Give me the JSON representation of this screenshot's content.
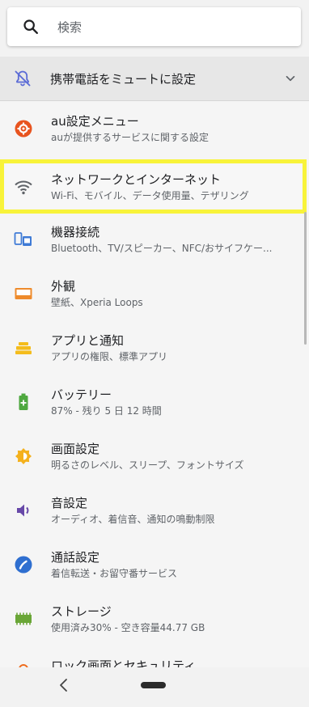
{
  "search": {
    "placeholder": "検索"
  },
  "suggestion": {
    "label": "携帯電話をミュートに設定"
  },
  "settings": [
    {
      "title": "au設定メニュー",
      "subtitle": "auが提供するサービスに関する設定",
      "icon": "au-gear-icon",
      "color": "#e8541f"
    },
    {
      "title": "ネットワークとインターネット",
      "subtitle": "Wi-Fi、モバイル、データ使用量、テザリング",
      "icon": "wifi-icon",
      "color": "#5f6368"
    },
    {
      "title": "機器接続",
      "subtitle": "Bluetooth、TV/スピーカー、NFC/おサイフケー...",
      "icon": "devices-icon",
      "color": "#3f7bd6"
    },
    {
      "title": "外観",
      "subtitle": "壁紙、Xperia Loops",
      "icon": "appearance-icon",
      "color": "#ee8b2c"
    },
    {
      "title": "アプリと通知",
      "subtitle": "アプリの権限、標準アプリ",
      "icon": "apps-icon",
      "color": "#f4bc1c"
    },
    {
      "title": "バッテリー",
      "subtitle": "87% - 残り 5 日 12 時間",
      "icon": "battery-icon",
      "color": "#4ea83f"
    },
    {
      "title": "画面設定",
      "subtitle": "明るさのレベル、スリープ、フォントサイズ",
      "icon": "brightness-icon",
      "color": "#f4b11c"
    },
    {
      "title": "音設定",
      "subtitle": "オーディオ、着信音、通知の鳴動制限",
      "icon": "volume-icon",
      "color": "#6748a8"
    },
    {
      "title": "通話設定",
      "subtitle": "着信転送・お留守番サービス",
      "icon": "phone-icon",
      "color": "#2f6fd0"
    },
    {
      "title": "ストレージ",
      "subtitle": "使用済み30% - 空き容量44.77 GB",
      "icon": "storage-icon",
      "color": "#6aa637"
    },
    {
      "title": "ロック画面とセキュリティ",
      "subtitle": "",
      "icon": "lock-icon",
      "color": "#ee6c1e"
    }
  ],
  "colors": {
    "highlight": "#f8f33a",
    "background": "#f5f5f5"
  }
}
